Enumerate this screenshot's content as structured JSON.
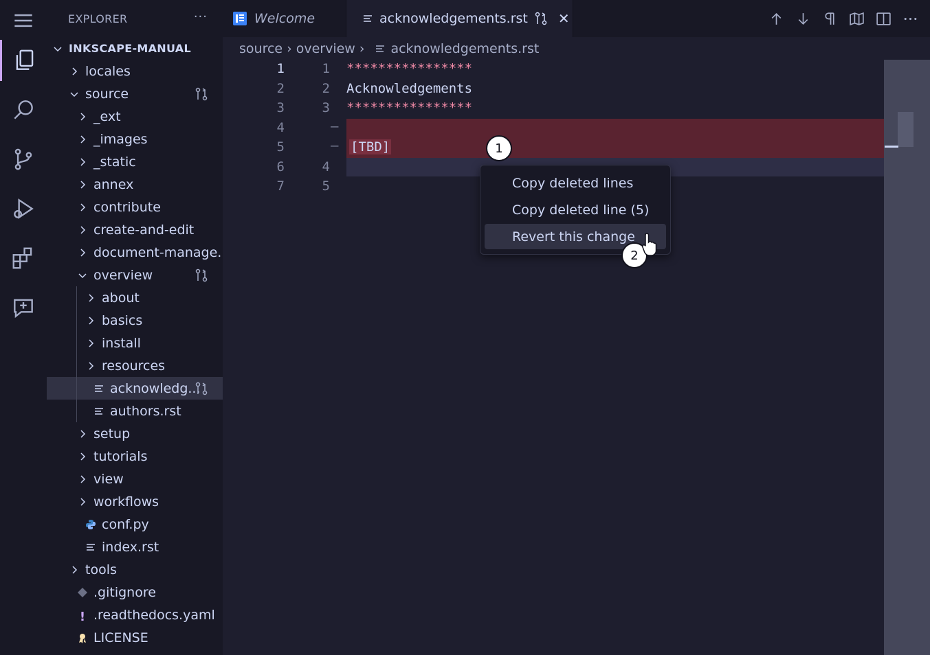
{
  "activity_bar": {
    "items": [
      {
        "name": "menu-icon"
      },
      {
        "name": "explorer-icon"
      },
      {
        "name": "search-icon"
      },
      {
        "name": "source-control-icon"
      },
      {
        "name": "run-debug-icon"
      },
      {
        "name": "extensions-icon"
      },
      {
        "name": "chat-icon"
      }
    ]
  },
  "sidebar": {
    "title": "EXPLORER",
    "more": "···",
    "root": "INKSCAPE-MANUAL",
    "tree": [
      {
        "label": "locales",
        "type": "folder",
        "open": false
      },
      {
        "label": "source",
        "type": "folder",
        "open": true,
        "changed": true
      },
      {
        "label": "_ext",
        "type": "folder",
        "open": false
      },
      {
        "label": "_images",
        "type": "folder",
        "open": false
      },
      {
        "label": "_static",
        "type": "folder",
        "open": false
      },
      {
        "label": "annex",
        "type": "folder",
        "open": false
      },
      {
        "label": "contribute",
        "type": "folder",
        "open": false
      },
      {
        "label": "create-and-edit",
        "type": "folder",
        "open": false
      },
      {
        "label": "document-manage...",
        "type": "folder",
        "open": false
      },
      {
        "label": "overview",
        "type": "folder",
        "open": true,
        "changed": true
      },
      {
        "label": "about",
        "type": "folder",
        "open": false
      },
      {
        "label": "basics",
        "type": "folder",
        "open": false
      },
      {
        "label": "install",
        "type": "folder",
        "open": false
      },
      {
        "label": "resources",
        "type": "folder",
        "open": false
      },
      {
        "label": "acknowledg...",
        "type": "file",
        "selected": true,
        "changed": true
      },
      {
        "label": "authors.rst",
        "type": "file"
      },
      {
        "label": "setup",
        "type": "folder",
        "open": false
      },
      {
        "label": "tutorials",
        "type": "folder",
        "open": false
      },
      {
        "label": "view",
        "type": "folder",
        "open": false
      },
      {
        "label": "workflows",
        "type": "folder",
        "open": false
      },
      {
        "label": "conf.py",
        "type": "python"
      },
      {
        "label": "index.rst",
        "type": "file"
      },
      {
        "label": "tools",
        "type": "folder",
        "open": false
      },
      {
        "label": ".gitignore",
        "type": "git"
      },
      {
        "label": ".readthedocs.yaml",
        "type": "yaml"
      },
      {
        "label": "LICENSE",
        "type": "license"
      }
    ]
  },
  "tabs": [
    {
      "label": "Welcome",
      "icon": "welcome-icon"
    },
    {
      "label": "acknowledgements.rst",
      "icon": "file-lines-icon",
      "active": true,
      "close": "✕"
    }
  ],
  "breadcrumb": [
    "source",
    "overview",
    "acknowledgements.rst"
  ],
  "editor": {
    "lines": [
      {
        "orig": "1",
        "mod": "1",
        "text": "****************",
        "kind": "stars"
      },
      {
        "orig": "2",
        "mod": "2",
        "text": "Acknowledgements",
        "kind": "normal"
      },
      {
        "orig": "3",
        "mod": "3",
        "text": "****************",
        "kind": "stars"
      },
      {
        "orig": "4",
        "mod": "",
        "text": "",
        "kind": "deleted",
        "marker": "—"
      },
      {
        "orig": "5",
        "mod": "",
        "text": "[TBD]",
        "kind": "deleted",
        "marker": "—"
      },
      {
        "orig": "6",
        "mod": "4",
        "text": "",
        "kind": "added"
      },
      {
        "orig": "7",
        "mod": "5",
        "text": "",
        "kind": "normal"
      }
    ]
  },
  "context_menu": {
    "items": [
      "Copy deleted lines",
      "Copy deleted line (5)",
      "Revert this change"
    ]
  },
  "markers": [
    "1",
    "2"
  ],
  "colors": {
    "accent": "#cba6f7",
    "deleted": "#5a2330",
    "stars": "#f38ba8"
  }
}
